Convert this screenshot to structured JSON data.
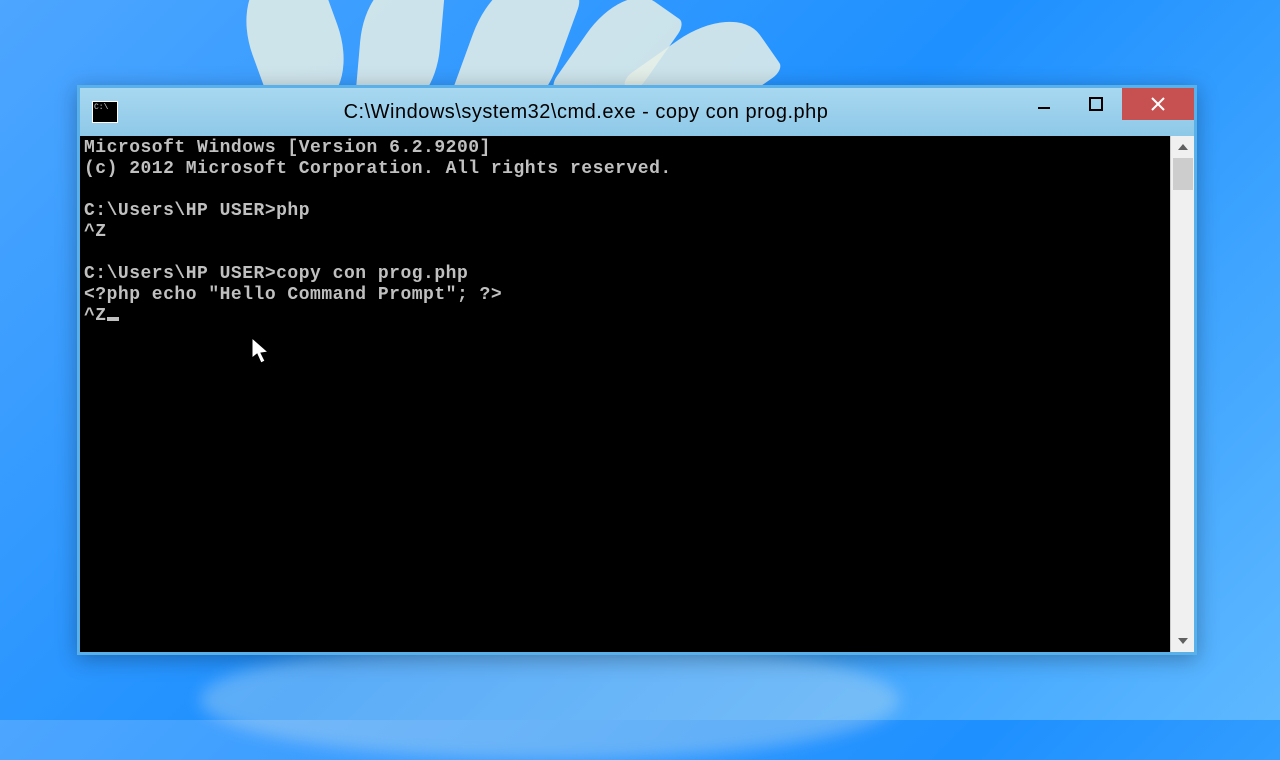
{
  "window": {
    "title": "C:\\Windows\\system32\\cmd.exe - copy  con prog.php"
  },
  "console": {
    "lines": [
      "Microsoft Windows [Version 6.2.9200]",
      "(c) 2012 Microsoft Corporation. All rights reserved.",
      "",
      "C:\\Users\\HP USER>php",
      "^Z",
      "",
      "C:\\Users\\HP USER>copy con prog.php",
      "<?php echo \"Hello Command Prompt\"; ?>",
      "^Z"
    ]
  }
}
